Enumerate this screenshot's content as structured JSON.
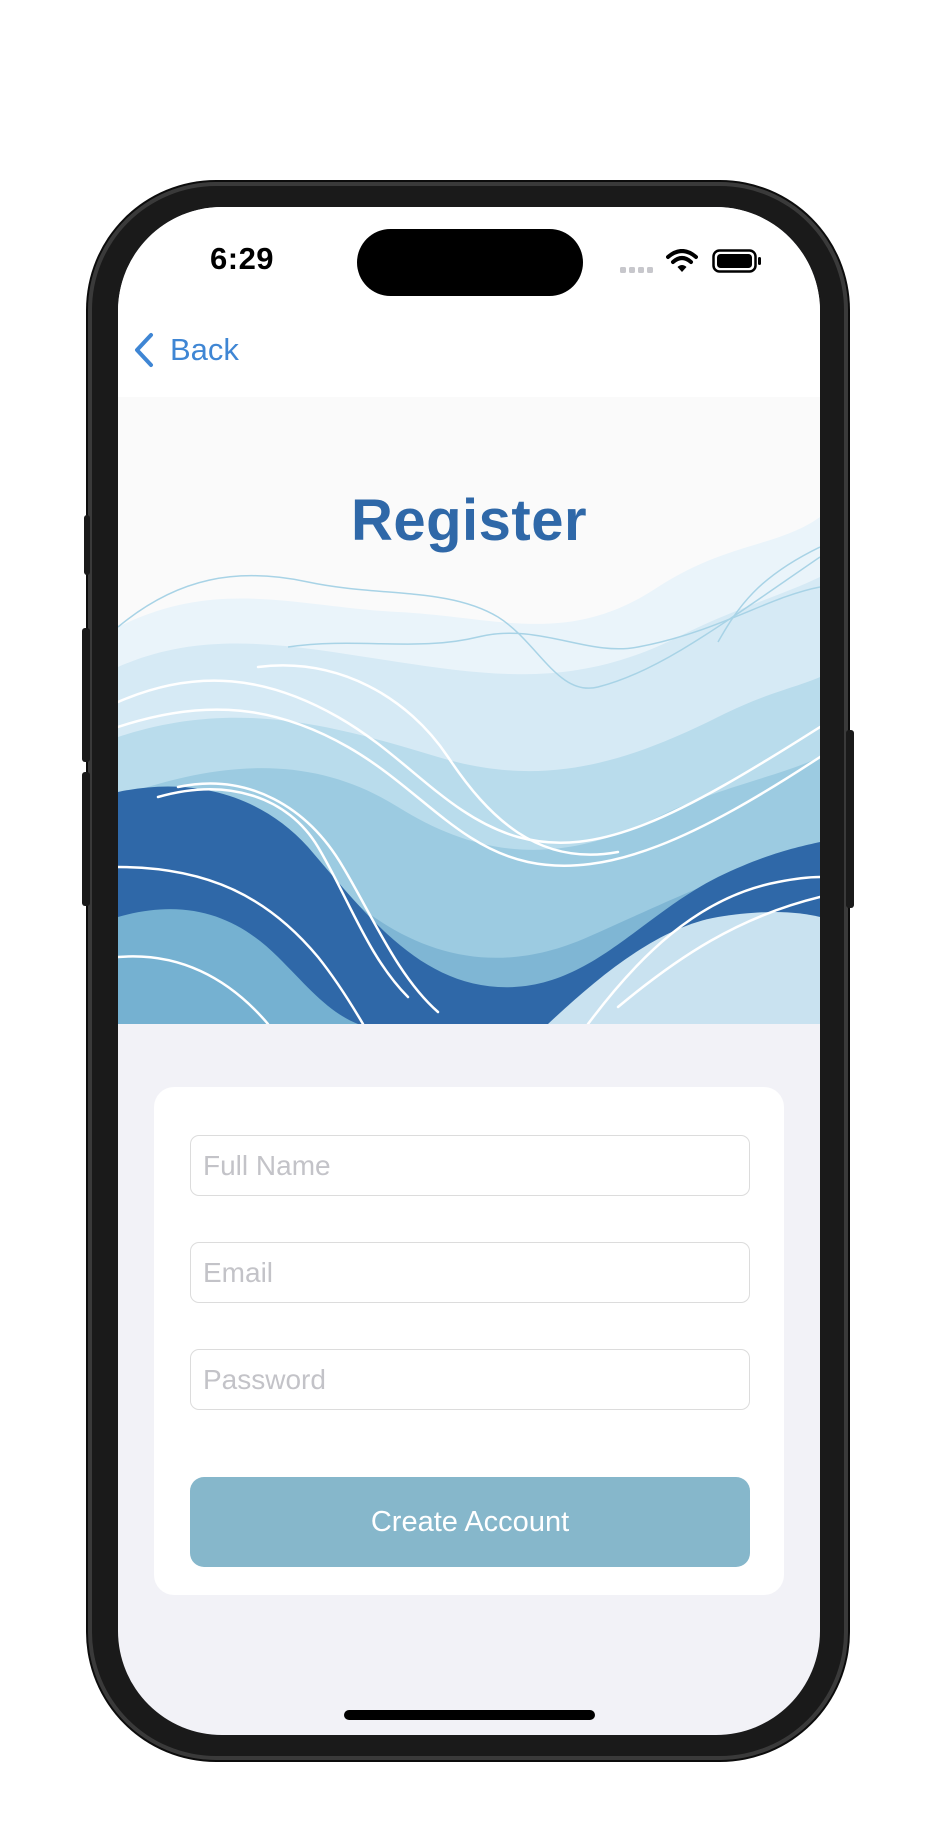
{
  "status_bar": {
    "time": "6:29",
    "icons": [
      "signal-icon",
      "wifi-icon",
      "battery-icon"
    ]
  },
  "nav": {
    "back_label": "Back",
    "back_icon": "chevron-left-icon"
  },
  "hero": {
    "title": "Register"
  },
  "form": {
    "full_name": {
      "placeholder": "Full Name",
      "value": ""
    },
    "email": {
      "placeholder": "Email",
      "value": ""
    },
    "password": {
      "placeholder": "Password",
      "value": ""
    },
    "submit_label": "Create Account"
  },
  "colors": {
    "accent": "#3f86d4",
    "title": "#2f68a8",
    "button": "#86b7cb",
    "background": "#f2f2f7",
    "wave_dark": "#2f68a8",
    "wave_light": "#d6eaf5"
  }
}
